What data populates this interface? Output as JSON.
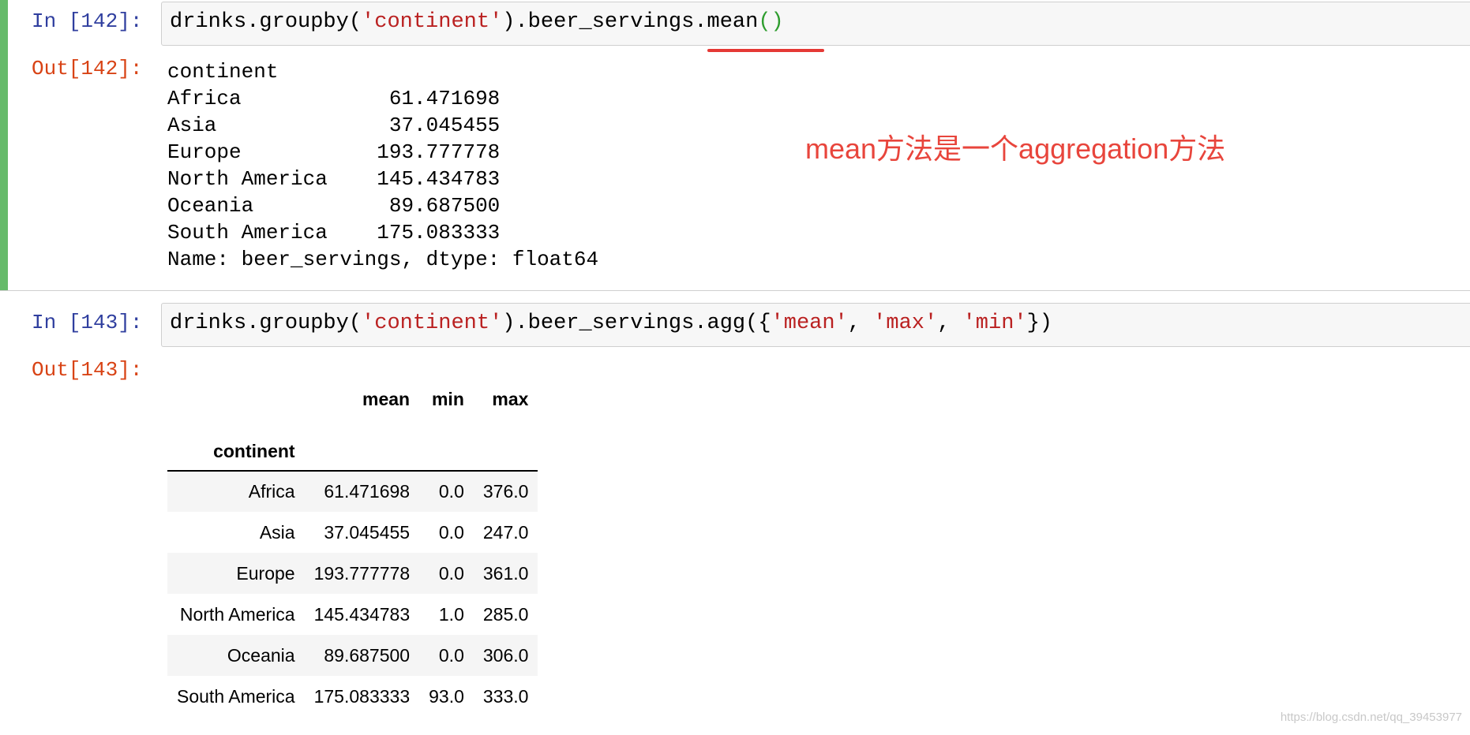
{
  "cell1": {
    "in_prompt": "In [142]:",
    "code": {
      "p1": "drinks.groupby(",
      "s1": "'continent'",
      "p2": ").beer_servings.mean",
      "p3": "()"
    },
    "out_prompt": "Out[142]:",
    "output": "continent\nAfrica            61.471698\nAsia              37.045455\nEurope           193.777778\nNorth America    145.434783\nOceania           89.687500\nSouth America    175.083333\nName: beer_servings, dtype: float64"
  },
  "annotation": "mean方法是一个aggregation方法",
  "cell2": {
    "in_prompt": "In [143]:",
    "code": {
      "p1": "drinks.groupby(",
      "s1": "'continent'",
      "p2": ").beer_servings.agg({",
      "s2": "'mean'",
      "c1": ", ",
      "s3": "'max'",
      "c2": ", ",
      "s4": "'min'",
      "p3": "})"
    },
    "out_prompt": "Out[143]:"
  },
  "table": {
    "columns": [
      "mean",
      "min",
      "max"
    ],
    "index_name": "continent",
    "rows": [
      {
        "label": "Africa",
        "values": [
          "61.471698",
          "0.0",
          "376.0"
        ]
      },
      {
        "label": "Asia",
        "values": [
          "37.045455",
          "0.0",
          "247.0"
        ]
      },
      {
        "label": "Europe",
        "values": [
          "193.777778",
          "0.0",
          "361.0"
        ]
      },
      {
        "label": "North America",
        "values": [
          "145.434783",
          "1.0",
          "285.0"
        ]
      },
      {
        "label": "Oceania",
        "values": [
          "89.687500",
          "0.0",
          "306.0"
        ]
      },
      {
        "label": "South America",
        "values": [
          "175.083333",
          "93.0",
          "333.0"
        ]
      }
    ]
  },
  "watermark": "https://blog.csdn.net/qq_39453977",
  "colors": {
    "selected_bar": "#66bb6a",
    "in_prompt": "#303f9f",
    "out_prompt": "#d84315",
    "string": "#ba2121",
    "annotation": "#e8453c"
  }
}
